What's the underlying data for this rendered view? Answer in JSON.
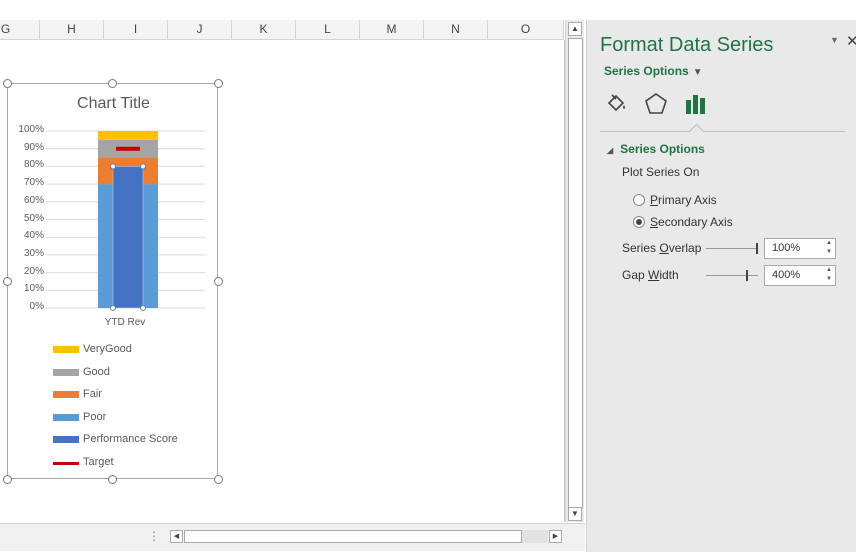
{
  "sheet": {
    "columns": [
      "G",
      "H",
      "I",
      "J",
      "K",
      "L",
      "M",
      "N",
      "O"
    ]
  },
  "chart": {
    "title": "Chart Title",
    "chart_data": {
      "type": "bar",
      "title": "Chart Title",
      "stacked": true,
      "categories": [
        "YTD Rev"
      ],
      "ylim": [
        0,
        1
      ],
      "y_ticks": [
        "0%",
        "10%",
        "20%",
        "30%",
        "40%",
        "50%",
        "60%",
        "70%",
        "80%",
        "90%",
        "100%"
      ],
      "grid": true,
      "legend_position": "bottom-left",
      "series": [
        {
          "name": "Poor",
          "values": [
            0.7
          ],
          "color": "#5B9BD5",
          "axis": "primary"
        },
        {
          "name": "Fair",
          "values": [
            0.15
          ],
          "color": "#ED7D31",
          "axis": "primary"
        },
        {
          "name": "Good",
          "values": [
            0.1
          ],
          "color": "#A5A5A5",
          "axis": "primary"
        },
        {
          "name": "VeryGood",
          "values": [
            0.05
          ],
          "color": "#FFC000",
          "axis": "primary"
        },
        {
          "name": "Performance Score",
          "values": [
            0.8
          ],
          "color": "#4472C4",
          "axis": "secondary"
        },
        {
          "name": "Target",
          "values": [
            0.9
          ],
          "color": "#C00000",
          "axis": "primary",
          "marker": "line"
        }
      ]
    },
    "legend": [
      {
        "label": "VeryGood",
        "color": "#FFC000",
        "kind": "box"
      },
      {
        "label": "Good",
        "color": "#A5A5A5",
        "kind": "box"
      },
      {
        "label": "Fair",
        "color": "#ED7D31",
        "kind": "box"
      },
      {
        "label": "Poor",
        "color": "#5B9BD5",
        "kind": "box"
      },
      {
        "label": "Performance Score",
        "color": "#4472C4",
        "kind": "box"
      },
      {
        "label": "Target",
        "color": "#C00000",
        "kind": "line"
      }
    ]
  },
  "pane": {
    "title": "Format Data Series",
    "pin_icon": "dropdown-caret-icon",
    "close_icon": "close-icon",
    "series_dropdown": "Series Options",
    "tabs": [
      {
        "name": "fill-line-icon"
      },
      {
        "name": "effects-icon"
      },
      {
        "name": "series-options-icon",
        "active": true
      }
    ],
    "section": "Series Options",
    "plot_series_on": "Plot Series On",
    "primary_axis": "Primary Axis",
    "secondary_axis": "Secondary Axis",
    "selected_axis": "secondary",
    "series_overlap_label": "Series Overlap",
    "series_overlap_value": "100%",
    "series_overlap_level": 1.0,
    "gap_width_label": "Gap Width",
    "gap_width_value": "400%",
    "gap_width_level": 0.8,
    "accent": "#217346"
  }
}
